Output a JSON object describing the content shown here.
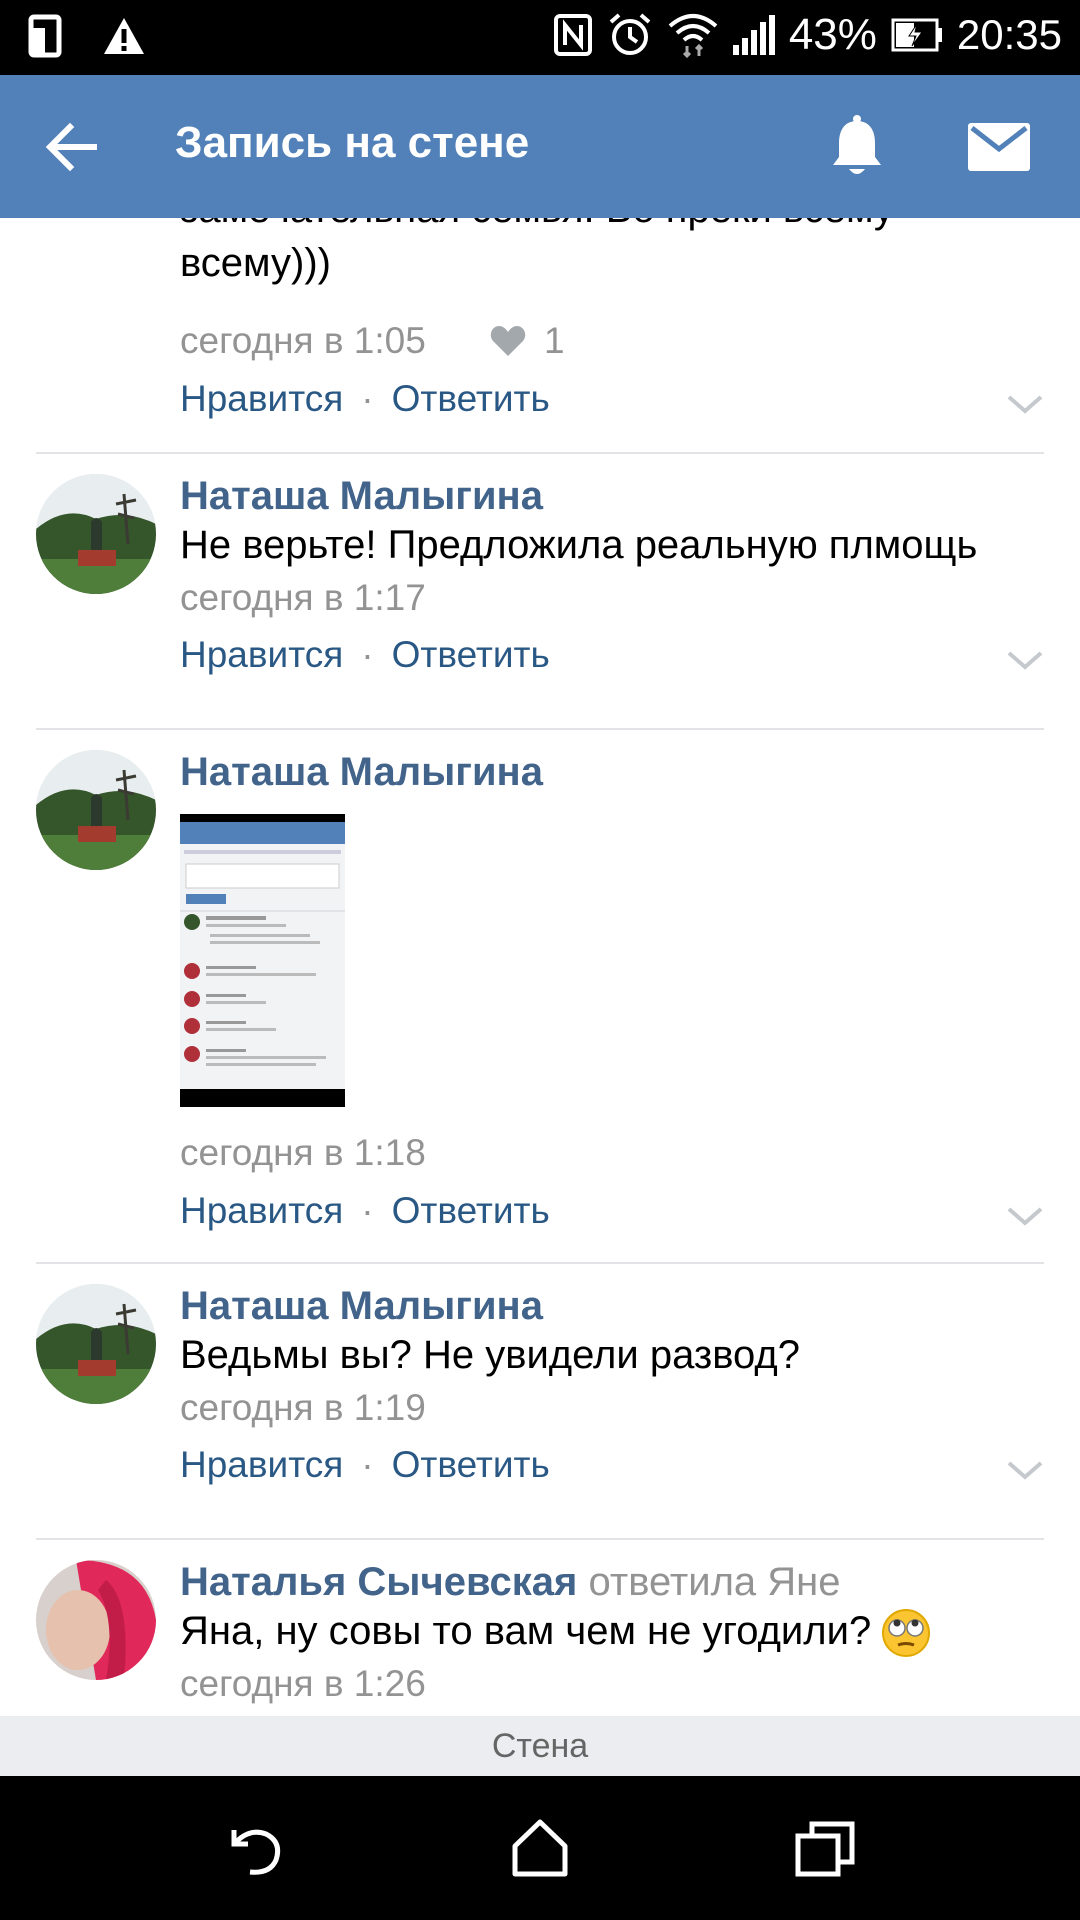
{
  "status_bar": {
    "battery": "43%",
    "time": "20:35",
    "icons": [
      "sim-card-icon",
      "warning-icon",
      "nfc-icon",
      "alarm-icon",
      "wifi-icon",
      "signal-icon",
      "battery-icon"
    ]
  },
  "header": {
    "title": "Запись на стене",
    "icons": [
      "back-arrow-icon",
      "bell-icon",
      "mail-icon"
    ]
  },
  "comments": [
    {
      "text_lines": [
        "замечательная семья. Во преки всему",
        "всему)))"
      ],
      "time": "сегодня в 1:05",
      "likes": "1",
      "like_label": "Нравится",
      "reply_label": "Ответить",
      "separator": "·"
    },
    {
      "author": "Наташа Малыгина",
      "text": "Не верьте! Предложила реальную плмощь",
      "time": "сегодня в 1:17",
      "like_label": "Нравится",
      "reply_label": "Ответить",
      "separator": "·"
    },
    {
      "author": "Наташа Малыгина",
      "attachment": "screenshot-thumbnail",
      "time": "сегодня в 1:18",
      "like_label": "Нравится",
      "reply_label": "Ответить",
      "separator": "·"
    },
    {
      "author": "Наташа Малыгина",
      "text": "Ведьмы вы? Не увидели развод?",
      "time": "сегодня в 1:19",
      "like_label": "Нравится",
      "reply_label": "Ответить",
      "separator": "·"
    },
    {
      "author": "Наталья Сычевская",
      "reply_to": "ответила Яне",
      "text": "Яна, ну совы то вам чем не угодили?",
      "time": "сегодня в 1:26"
    }
  ],
  "bottom_tab": {
    "label": "Стена"
  },
  "nav_bar": {
    "icons": [
      "back-icon",
      "home-icon",
      "recents-icon"
    ]
  },
  "colors": {
    "header": "#5181b8",
    "link": "#2a5885",
    "name": "#42648b",
    "muted": "#939393"
  }
}
